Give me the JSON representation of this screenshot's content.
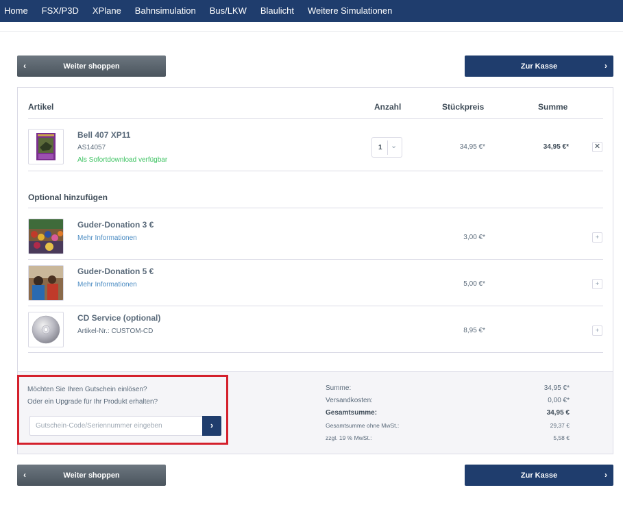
{
  "nav": {
    "items": [
      "Home",
      "FSX/P3D",
      "XPlane",
      "Bahnsimulation",
      "Bus/LKW",
      "Blaulicht",
      "Weitere Simulationen"
    ]
  },
  "buttons": {
    "continue_shopping": "Weiter shoppen",
    "checkout": "Zur Kasse"
  },
  "cart": {
    "headers": {
      "article": "Artikel",
      "quantity": "Anzahl",
      "unit_price": "Stückpreis",
      "total": "Summe"
    },
    "item": {
      "name": "Bell 407 XP11",
      "sku": "AS14057",
      "availability": "Als Sofortdownload verfügbar",
      "quantity": "1",
      "unit_price": "34,95 €*",
      "total": "34,95 €*",
      "remove": "✕"
    },
    "optional_title": "Optional hinzufügen",
    "optional_items": [
      {
        "name": "Guder-Donation 3 €",
        "sub": "Mehr Informationen",
        "price": "3,00 €*",
        "add": "+"
      },
      {
        "name": "Guder-Donation 5 €",
        "sub": "Mehr Informationen",
        "price": "5,00 €*",
        "add": "+"
      },
      {
        "name": "CD Service (optional)",
        "sub": "Artikel-Nr.: CUSTOM-CD",
        "price": "8,95 €*",
        "add": "+"
      }
    ]
  },
  "voucher": {
    "line1": "Möchten Sie Ihren Gutschein einlösen?",
    "line2": "Oder ein Upgrade für Ihr Produkt erhalten?",
    "placeholder": "Gutschein-Code/Seriennummer eingeben",
    "submit_icon": "›",
    "highlight_color": "#d4202c"
  },
  "summary": {
    "rows": [
      {
        "label": "Summe:",
        "value": "34,95 €*"
      },
      {
        "label": "Versandkosten:",
        "value": "0,00 €*"
      },
      {
        "label": "Gesamtsumme:",
        "value": "34,95 €"
      },
      {
        "label": "Gesamtsumme ohne MwSt.:",
        "value": "29,37 €"
      },
      {
        "label": "zzgl. 19 % MwSt.:",
        "value": "5,58 €"
      }
    ]
  },
  "icons": {
    "chevron_left": "‹",
    "chevron_right": "›",
    "chevron_down": "⌄"
  },
  "colors": {
    "brand": "#1f3d6d",
    "availability": "#3cc261",
    "link": "#4a8bc2"
  }
}
